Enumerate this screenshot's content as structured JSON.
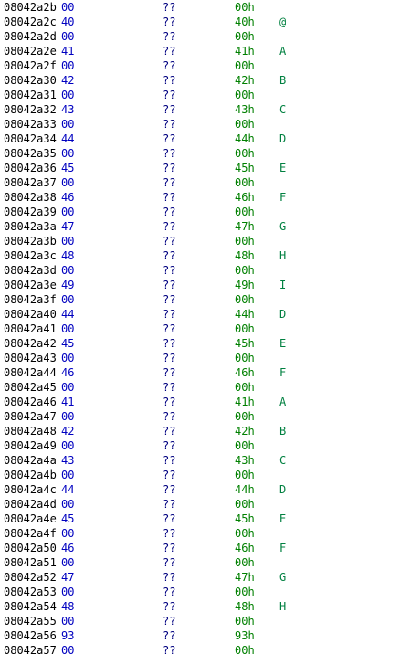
{
  "listing": {
    "colors": {
      "address": "#000000",
      "byte": "#0000c0",
      "mnemonic": "#000080",
      "operand": "#008000",
      "char": "#008040",
      "background": "#ffffff"
    },
    "rows": [
      {
        "addr": "08042a2b",
        "byte": "00",
        "mnem": "??",
        "oper": "00h",
        "char": ""
      },
      {
        "addr": "08042a2c",
        "byte": "40",
        "mnem": "??",
        "oper": "40h",
        "char": "@"
      },
      {
        "addr": "08042a2d",
        "byte": "00",
        "mnem": "??",
        "oper": "00h",
        "char": ""
      },
      {
        "addr": "08042a2e",
        "byte": "41",
        "mnem": "??",
        "oper": "41h",
        "char": "A"
      },
      {
        "addr": "08042a2f",
        "byte": "00",
        "mnem": "??",
        "oper": "00h",
        "char": ""
      },
      {
        "addr": "08042a30",
        "byte": "42",
        "mnem": "??",
        "oper": "42h",
        "char": "B"
      },
      {
        "addr": "08042a31",
        "byte": "00",
        "mnem": "??",
        "oper": "00h",
        "char": ""
      },
      {
        "addr": "08042a32",
        "byte": "43",
        "mnem": "??",
        "oper": "43h",
        "char": "C"
      },
      {
        "addr": "08042a33",
        "byte": "00",
        "mnem": "??",
        "oper": "00h",
        "char": ""
      },
      {
        "addr": "08042a34",
        "byte": "44",
        "mnem": "??",
        "oper": "44h",
        "char": "D"
      },
      {
        "addr": "08042a35",
        "byte": "00",
        "mnem": "??",
        "oper": "00h",
        "char": ""
      },
      {
        "addr": "08042a36",
        "byte": "45",
        "mnem": "??",
        "oper": "45h",
        "char": "E"
      },
      {
        "addr": "08042a37",
        "byte": "00",
        "mnem": "??",
        "oper": "00h",
        "char": ""
      },
      {
        "addr": "08042a38",
        "byte": "46",
        "mnem": "??",
        "oper": "46h",
        "char": "F"
      },
      {
        "addr": "08042a39",
        "byte": "00",
        "mnem": "??",
        "oper": "00h",
        "char": ""
      },
      {
        "addr": "08042a3a",
        "byte": "47",
        "mnem": "??",
        "oper": "47h",
        "char": "G"
      },
      {
        "addr": "08042a3b",
        "byte": "00",
        "mnem": "??",
        "oper": "00h",
        "char": ""
      },
      {
        "addr": "08042a3c",
        "byte": "48",
        "mnem": "??",
        "oper": "48h",
        "char": "H"
      },
      {
        "addr": "08042a3d",
        "byte": "00",
        "mnem": "??",
        "oper": "00h",
        "char": ""
      },
      {
        "addr": "08042a3e",
        "byte": "49",
        "mnem": "??",
        "oper": "49h",
        "char": "I"
      },
      {
        "addr": "08042a3f",
        "byte": "00",
        "mnem": "??",
        "oper": "00h",
        "char": ""
      },
      {
        "addr": "08042a40",
        "byte": "44",
        "mnem": "??",
        "oper": "44h",
        "char": "D"
      },
      {
        "addr": "08042a41",
        "byte": "00",
        "mnem": "??",
        "oper": "00h",
        "char": ""
      },
      {
        "addr": "08042a42",
        "byte": "45",
        "mnem": "??",
        "oper": "45h",
        "char": "E"
      },
      {
        "addr": "08042a43",
        "byte": "00",
        "mnem": "??",
        "oper": "00h",
        "char": ""
      },
      {
        "addr": "08042a44",
        "byte": "46",
        "mnem": "??",
        "oper": "46h",
        "char": "F"
      },
      {
        "addr": "08042a45",
        "byte": "00",
        "mnem": "??",
        "oper": "00h",
        "char": ""
      },
      {
        "addr": "08042a46",
        "byte": "41",
        "mnem": "??",
        "oper": "41h",
        "char": "A"
      },
      {
        "addr": "08042a47",
        "byte": "00",
        "mnem": "??",
        "oper": "00h",
        "char": ""
      },
      {
        "addr": "08042a48",
        "byte": "42",
        "mnem": "??",
        "oper": "42h",
        "char": "B"
      },
      {
        "addr": "08042a49",
        "byte": "00",
        "mnem": "??",
        "oper": "00h",
        "char": ""
      },
      {
        "addr": "08042a4a",
        "byte": "43",
        "mnem": "??",
        "oper": "43h",
        "char": "C"
      },
      {
        "addr": "08042a4b",
        "byte": "00",
        "mnem": "??",
        "oper": "00h",
        "char": ""
      },
      {
        "addr": "08042a4c",
        "byte": "44",
        "mnem": "??",
        "oper": "44h",
        "char": "D"
      },
      {
        "addr": "08042a4d",
        "byte": "00",
        "mnem": "??",
        "oper": "00h",
        "char": ""
      },
      {
        "addr": "08042a4e",
        "byte": "45",
        "mnem": "??",
        "oper": "45h",
        "char": "E"
      },
      {
        "addr": "08042a4f",
        "byte": "00",
        "mnem": "??",
        "oper": "00h",
        "char": ""
      },
      {
        "addr": "08042a50",
        "byte": "46",
        "mnem": "??",
        "oper": "46h",
        "char": "F"
      },
      {
        "addr": "08042a51",
        "byte": "00",
        "mnem": "??",
        "oper": "00h",
        "char": ""
      },
      {
        "addr": "08042a52",
        "byte": "47",
        "mnem": "??",
        "oper": "47h",
        "char": "G"
      },
      {
        "addr": "08042a53",
        "byte": "00",
        "mnem": "??",
        "oper": "00h",
        "char": ""
      },
      {
        "addr": "08042a54",
        "byte": "48",
        "mnem": "??",
        "oper": "48h",
        "char": "H"
      },
      {
        "addr": "08042a55",
        "byte": "00",
        "mnem": "??",
        "oper": "00h",
        "char": ""
      },
      {
        "addr": "08042a56",
        "byte": "93",
        "mnem": "??",
        "oper": "93h",
        "char": ""
      },
      {
        "addr": "08042a57",
        "byte": "00",
        "mnem": "??",
        "oper": "00h",
        "char": ""
      }
    ]
  }
}
